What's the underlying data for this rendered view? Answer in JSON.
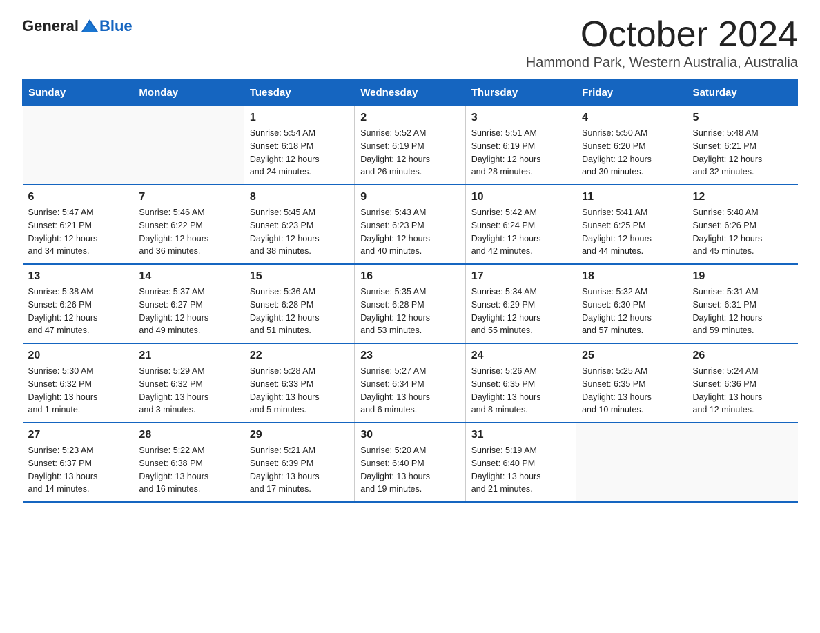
{
  "header": {
    "logo_general": "General",
    "logo_blue": "Blue",
    "title": "October 2024",
    "subtitle": "Hammond Park, Western Australia, Australia"
  },
  "weekdays": [
    "Sunday",
    "Monday",
    "Tuesday",
    "Wednesday",
    "Thursday",
    "Friday",
    "Saturday"
  ],
  "weeks": [
    [
      {
        "day": "",
        "detail": ""
      },
      {
        "day": "",
        "detail": ""
      },
      {
        "day": "1",
        "detail": "Sunrise: 5:54 AM\nSunset: 6:18 PM\nDaylight: 12 hours\nand 24 minutes."
      },
      {
        "day": "2",
        "detail": "Sunrise: 5:52 AM\nSunset: 6:19 PM\nDaylight: 12 hours\nand 26 minutes."
      },
      {
        "day": "3",
        "detail": "Sunrise: 5:51 AM\nSunset: 6:19 PM\nDaylight: 12 hours\nand 28 minutes."
      },
      {
        "day": "4",
        "detail": "Sunrise: 5:50 AM\nSunset: 6:20 PM\nDaylight: 12 hours\nand 30 minutes."
      },
      {
        "day": "5",
        "detail": "Sunrise: 5:48 AM\nSunset: 6:21 PM\nDaylight: 12 hours\nand 32 minutes."
      }
    ],
    [
      {
        "day": "6",
        "detail": "Sunrise: 5:47 AM\nSunset: 6:21 PM\nDaylight: 12 hours\nand 34 minutes."
      },
      {
        "day": "7",
        "detail": "Sunrise: 5:46 AM\nSunset: 6:22 PM\nDaylight: 12 hours\nand 36 minutes."
      },
      {
        "day": "8",
        "detail": "Sunrise: 5:45 AM\nSunset: 6:23 PM\nDaylight: 12 hours\nand 38 minutes."
      },
      {
        "day": "9",
        "detail": "Sunrise: 5:43 AM\nSunset: 6:23 PM\nDaylight: 12 hours\nand 40 minutes."
      },
      {
        "day": "10",
        "detail": "Sunrise: 5:42 AM\nSunset: 6:24 PM\nDaylight: 12 hours\nand 42 minutes."
      },
      {
        "day": "11",
        "detail": "Sunrise: 5:41 AM\nSunset: 6:25 PM\nDaylight: 12 hours\nand 44 minutes."
      },
      {
        "day": "12",
        "detail": "Sunrise: 5:40 AM\nSunset: 6:26 PM\nDaylight: 12 hours\nand 45 minutes."
      }
    ],
    [
      {
        "day": "13",
        "detail": "Sunrise: 5:38 AM\nSunset: 6:26 PM\nDaylight: 12 hours\nand 47 minutes."
      },
      {
        "day": "14",
        "detail": "Sunrise: 5:37 AM\nSunset: 6:27 PM\nDaylight: 12 hours\nand 49 minutes."
      },
      {
        "day": "15",
        "detail": "Sunrise: 5:36 AM\nSunset: 6:28 PM\nDaylight: 12 hours\nand 51 minutes."
      },
      {
        "day": "16",
        "detail": "Sunrise: 5:35 AM\nSunset: 6:28 PM\nDaylight: 12 hours\nand 53 minutes."
      },
      {
        "day": "17",
        "detail": "Sunrise: 5:34 AM\nSunset: 6:29 PM\nDaylight: 12 hours\nand 55 minutes."
      },
      {
        "day": "18",
        "detail": "Sunrise: 5:32 AM\nSunset: 6:30 PM\nDaylight: 12 hours\nand 57 minutes."
      },
      {
        "day": "19",
        "detail": "Sunrise: 5:31 AM\nSunset: 6:31 PM\nDaylight: 12 hours\nand 59 minutes."
      }
    ],
    [
      {
        "day": "20",
        "detail": "Sunrise: 5:30 AM\nSunset: 6:32 PM\nDaylight: 13 hours\nand 1 minute."
      },
      {
        "day": "21",
        "detail": "Sunrise: 5:29 AM\nSunset: 6:32 PM\nDaylight: 13 hours\nand 3 minutes."
      },
      {
        "day": "22",
        "detail": "Sunrise: 5:28 AM\nSunset: 6:33 PM\nDaylight: 13 hours\nand 5 minutes."
      },
      {
        "day": "23",
        "detail": "Sunrise: 5:27 AM\nSunset: 6:34 PM\nDaylight: 13 hours\nand 6 minutes."
      },
      {
        "day": "24",
        "detail": "Sunrise: 5:26 AM\nSunset: 6:35 PM\nDaylight: 13 hours\nand 8 minutes."
      },
      {
        "day": "25",
        "detail": "Sunrise: 5:25 AM\nSunset: 6:35 PM\nDaylight: 13 hours\nand 10 minutes."
      },
      {
        "day": "26",
        "detail": "Sunrise: 5:24 AM\nSunset: 6:36 PM\nDaylight: 13 hours\nand 12 minutes."
      }
    ],
    [
      {
        "day": "27",
        "detail": "Sunrise: 5:23 AM\nSunset: 6:37 PM\nDaylight: 13 hours\nand 14 minutes."
      },
      {
        "day": "28",
        "detail": "Sunrise: 5:22 AM\nSunset: 6:38 PM\nDaylight: 13 hours\nand 16 minutes."
      },
      {
        "day": "29",
        "detail": "Sunrise: 5:21 AM\nSunset: 6:39 PM\nDaylight: 13 hours\nand 17 minutes."
      },
      {
        "day": "30",
        "detail": "Sunrise: 5:20 AM\nSunset: 6:40 PM\nDaylight: 13 hours\nand 19 minutes."
      },
      {
        "day": "31",
        "detail": "Sunrise: 5:19 AM\nSunset: 6:40 PM\nDaylight: 13 hours\nand 21 minutes."
      },
      {
        "day": "",
        "detail": ""
      },
      {
        "day": "",
        "detail": ""
      }
    ]
  ]
}
